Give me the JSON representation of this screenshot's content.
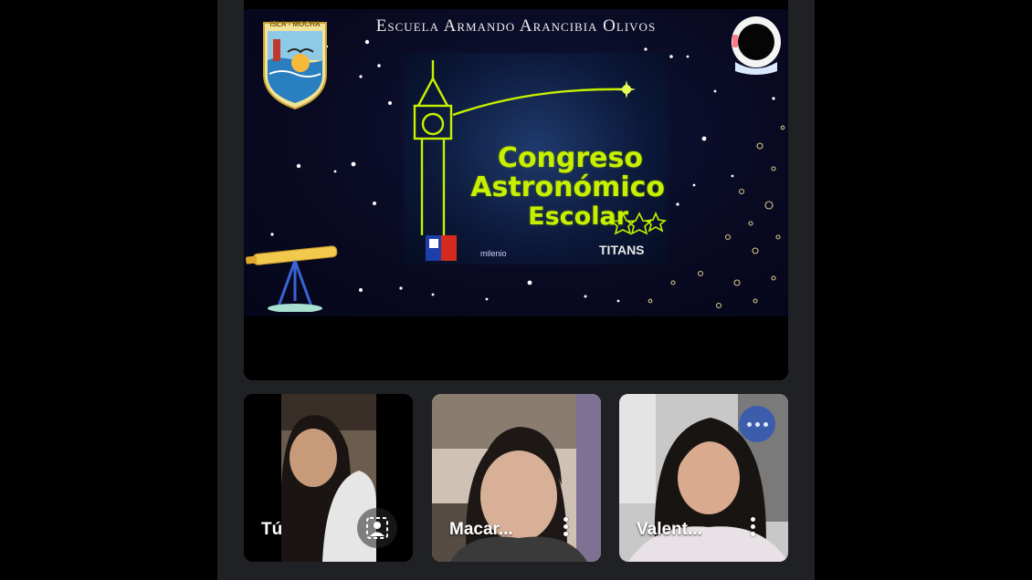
{
  "slide": {
    "school_name": "Escuela Armando Arancibia Olivos",
    "crest_label": "ISLA - MOCHA",
    "card": {
      "line1": "Congreso",
      "line2": "Astronómico",
      "line3": "Escolar",
      "sponsor": "milenio",
      "team": "TITANS"
    }
  },
  "participants": [
    {
      "name": "Tú"
    },
    {
      "name": "Macar..."
    },
    {
      "name": "Valent..."
    }
  ],
  "icons": {
    "background_effects": "background-effects-icon",
    "more_options": "more-vert-icon",
    "more_horizontal": "more-horiz-icon"
  },
  "colors": {
    "app_bg": "#202124",
    "accent_green": "#c6f000",
    "dots_badge": "#3c5dac"
  }
}
